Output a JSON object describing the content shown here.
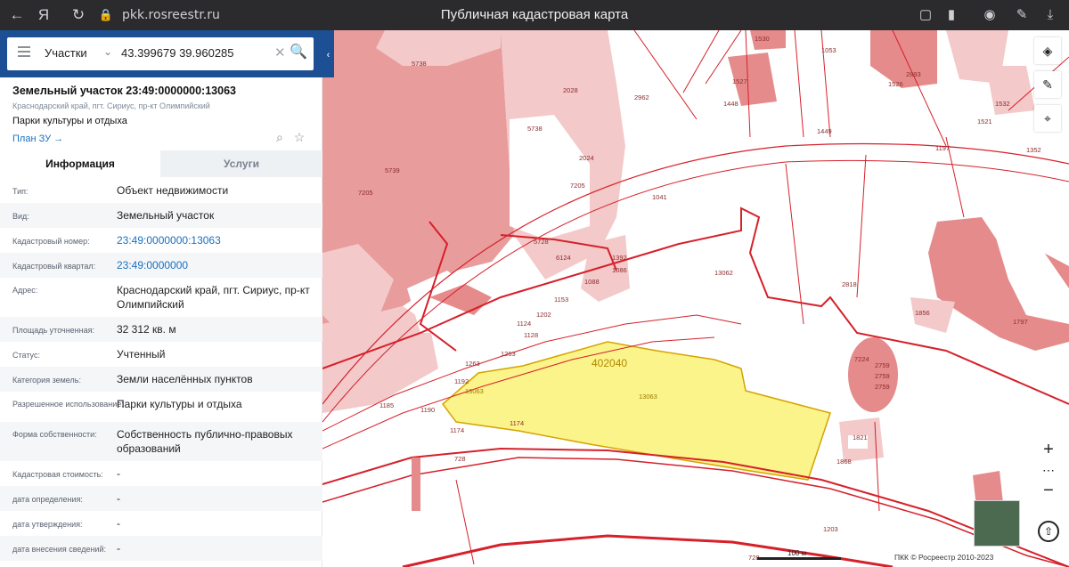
{
  "browser": {
    "url": "pkk.rosreestr.ru",
    "title": "Публичная кадастровая карта"
  },
  "search": {
    "type": "Участки",
    "value": "43.399679 39.960285"
  },
  "object": {
    "title": "Земельный участок 23:49:0000000:13063",
    "address_short": "Краснодарский край, пгт. Сириус, пр-кт Олимпийский",
    "usage": "Парки культуры и отдыха",
    "plan_link": "План ЗУ"
  },
  "tabs": {
    "info": "Информация",
    "services": "Услуги"
  },
  "rows": [
    {
      "k": "Тип:",
      "v": "Объект недвижимости",
      "link": false
    },
    {
      "k": "Вид:",
      "v": "Земельный участок",
      "link": false
    },
    {
      "k": "Кадастровый номер:",
      "v": "23:49:0000000:13063",
      "link": true
    },
    {
      "k": "Кадастровый квартал:",
      "v": "23:49:0000000",
      "link": true
    },
    {
      "k": "Адрес:",
      "v": "Краснодарский край, пгт. Сириус, пр-кт Олимпийский",
      "link": false
    },
    {
      "k": "Площадь уточненная:",
      "v": "32 312 кв. м",
      "link": false
    },
    {
      "k": "Статус:",
      "v": "Учтенный",
      "link": false
    },
    {
      "k": "Категория земель:",
      "v": "Земли населённых пунктов",
      "link": false
    },
    {
      "k": "Разрешенное использование:",
      "v": "Парки культуры и отдыха",
      "link": false
    },
    {
      "k": "Форма собственности:",
      "v": "Собственность публично-правовых образований",
      "link": false
    },
    {
      "k": "Кадастровая стоимость:",
      "v": "-",
      "link": false
    },
    {
      "k": "дата определения:",
      "v": "-",
      "link": false
    },
    {
      "k": "дата утверждения:",
      "v": "-",
      "link": false
    },
    {
      "k": "дата внесения сведений:",
      "v": "-",
      "link": false
    }
  ],
  "map": {
    "parcel_labels": [
      "5738",
      "5739",
      "7205",
      "2028",
      "2962",
      "1530",
      "1053",
      "2893",
      "1527",
      "1448",
      "1526",
      "1521",
      "1532",
      "1449",
      "1352",
      "1197",
      "5738",
      "2024",
      "7205",
      "1041",
      "13062",
      "2818",
      "1856",
      "1797",
      "7224",
      "2759",
      "2759",
      "2759",
      "1868",
      "1821",
      "402040",
      "13063",
      "13063",
      "1263",
      "1263",
      "1192",
      "1185",
      "1190",
      "1174",
      "1174",
      "728",
      "1128",
      "1124",
      "1202",
      "1153",
      "1088",
      "1086",
      "1392",
      "6124",
      "5728",
      "1203",
      "728"
    ],
    "scale_label": "100 м",
    "attribution": "ПКК © Росреестр 2010-2023"
  },
  "colors": {
    "header_blue": "#1d4f94",
    "link_blue": "#1a6fc0",
    "building_red": "#e07a7a",
    "parcel_pink": "#f2c4c4",
    "boundary_red": "#d6202a",
    "selected_yellow": "#fbf48a"
  }
}
